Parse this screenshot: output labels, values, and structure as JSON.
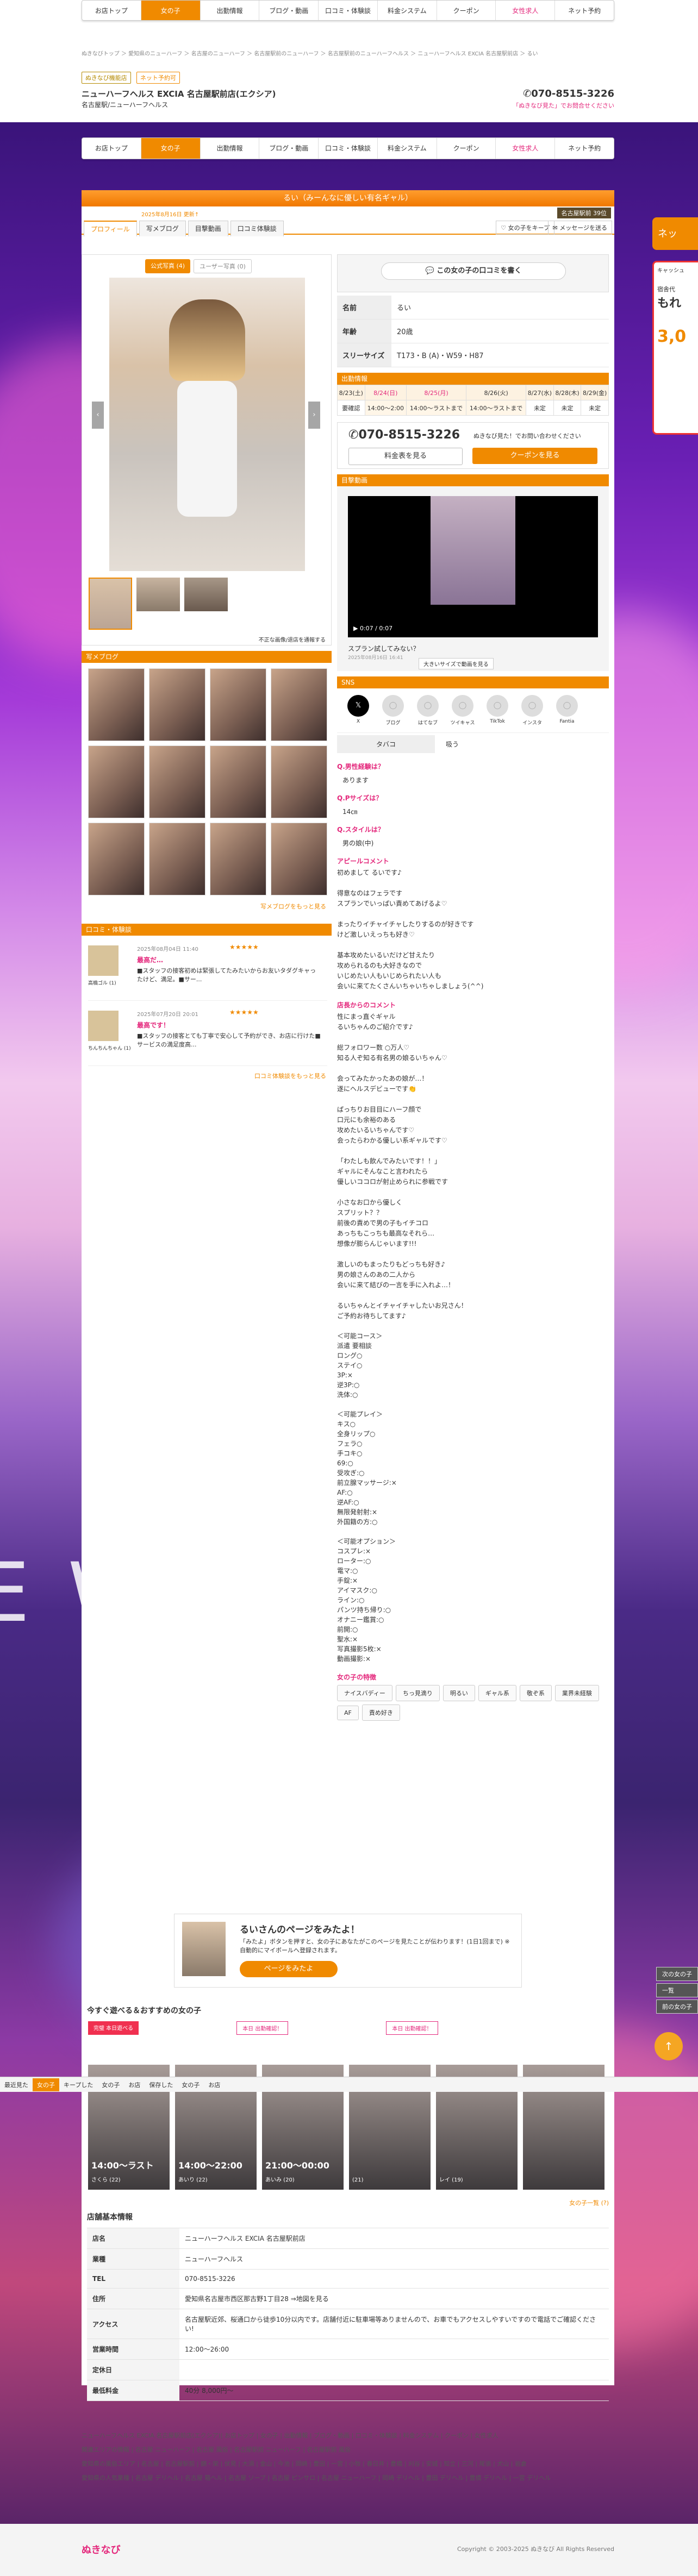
{
  "nav": [
    "お店トップ",
    "女の子",
    "出勤情報",
    "ブログ・動画",
    "口コミ・体験談",
    "料金システム",
    "クーポン",
    "女性求人",
    "ネット予約"
  ],
  "topbar": {
    "badge1": "ぬきなび機能店",
    "badge2": "ネット予約可",
    "shop_name": "ニューハーフヘルス EXCIA 名古屋駅前店(エクシア)",
    "shop_sub": "名古屋駅/ニューハーフヘルス",
    "phone": "070-8515-3226",
    "phone_note": "「ぬきなび見た」でお問合せください",
    "breadcrumb": "ぬきなびトップ ＞ 愛知県のニューハーフ ＞ 名古屋のニューハーフ ＞ 名古屋駅前のニューハーフ ＞ 名古屋駅前のニューハーフヘルス ＞ ニューハーフヘルス EXCIA 名古屋駅前店 ＞ るい"
  },
  "profile_header": {
    "title": "るい（みーんなに優しい有名ギャル）",
    "updated": "2025年8月16日 更新↑",
    "views": "名古屋駅前 39位",
    "fav_btn": "女の子をキープ",
    "mail_btn": "メッセージを送る"
  },
  "tabs": [
    "プロフィール",
    "写メブログ",
    "目撃動画",
    "口コミ体験談"
  ],
  "photo_tabs": [
    "公式写真 (4)",
    "ユーザー写真 (0)"
  ],
  "photo_report": "不正な画像/退店を通報する",
  "review_btn": "この女の子の口コミを書く",
  "profile": [
    {
      "label": "名前",
      "value": "るい"
    },
    {
      "label": "年齢",
      "value": "20歳"
    },
    {
      "label": "スリーサイズ",
      "value": "T173・B (A)・W59・H87"
    }
  ],
  "schedule": {
    "title": "出勤情報",
    "days": [
      "8/23(土)",
      "8/24(日)",
      "8/25(月)",
      "8/26(火)",
      "8/27(水)",
      "8/28(木)",
      "8/29(金)"
    ],
    "times": [
      "要確認",
      "14:00〜2:00",
      "14:00〜ラストまで",
      "14:00〜ラストまで",
      "未定",
      "未定",
      "未定"
    ]
  },
  "contact": {
    "phone": "070-8515-3226",
    "note": "ぬきなび見た！でお問い合わせください",
    "price_btn": "料金表を見る",
    "coupon_btn": "クーポンを見る"
  },
  "video": {
    "title": "目撃動画",
    "time": "0:07 / 0:07",
    "caption": "スプラン試してみない？",
    "date": "2025年08月16日 16:41",
    "big_btn": "大きいサイズで動画を見る"
  },
  "sns": {
    "title": "SNS",
    "items": [
      "X",
      "ブログ",
      "はてなブ",
      "ツイキャス",
      "TikTok",
      "インスタ",
      "Fantia"
    ]
  },
  "qa_tabs": [
    "タバコ",
    "吸う"
  ],
  "qa": [
    {
      "q": "Q.男性経験は？",
      "a": "あります"
    },
    {
      "q": "Q.Pサイズは？",
      "a": "14㎝"
    },
    {
      "q": "Q.スタイルは？",
      "a": "男の娘(中)"
    }
  ],
  "appeal": {
    "title": "アピールコメント",
    "text": "初めまして るいです♪\n\n得意なのはフェラです\nスプランでいっぱい責めてあげるよ♡\n\nまったりイチャイチャしたりするのが好きです\nけど激しいえっちも好き♡\n\n基本攻めたいるいだけど甘えたり\n攻められるのも大好きなので\nいじめたい人もいじめられたい人も\n会いに来てたくさんいちゃいちゃしましょう(^^)"
  },
  "staff": {
    "title": "店長からのコメント",
    "text": "性にまっ直ぐギャル\nるいちゃんのご紹介です♪\n\n総フォロワー数 ○万人♡\n知る人ぞ知る有名男の娘るいちゃん♡\n\n会ってみたかったあの娘が…！\n遂にヘルスデビューです👏\n\nぱっちりお目目にハーフ顔で\n口元にも余裕のある\n攻めたいるいちゃんです♡\n会ったらわかる優しい系ギャルです♡\n\n「わたしも飲んでみたいです！！」\nギャルにそんなこと言われたら\n優しいココロが射止められに参戦です\n\n小さなお口から優しく\nスプリット？？\n前後の責めで男の子もイチコロ\nあっちもこっちも最高なそれら…\n想像が膨らんじゃいます!!!\n\n激しいのもまったりもどっちも好き♪\n男の娘さんのあの二人から\n会いに来て結びの一言を手に入れよ…！\n\nるいちゃんとイチャイチャしたいお兄さん！\nご予約お待ちしてます♪"
  },
  "options": {
    "course_title": "＜可能コース＞",
    "courses": [
      "派遣 要相談",
      "ロング○",
      "ステイ○",
      "3P:×",
      "逆3P:○",
      "洗体:○"
    ],
    "play_title": "＜可能プレイ＞",
    "plays": [
      "キス○",
      "全身リップ○",
      "フェラ○",
      "手コキ○",
      "69:○",
      "受攻ぎ:○",
      "前立腺マッサージ:×",
      "AF:○",
      "逆AF:○",
      "無限発射射:×",
      "外国籍の方:○"
    ],
    "opt_title": "＜可能オプション＞",
    "opts": [
      "コスプレ:×",
      "ローター:○",
      "電マ:○",
      "手錠:×",
      "アイマスク:○",
      "ライン:○",
      "パンツ持ち帰り:○",
      "オナニー鑑賞:○",
      "前開:○",
      "聖水:×",
      "写真撮影5枚:×",
      "動画撮影:×"
    ]
  },
  "traits": {
    "title": "女の子の特徴",
    "tags": [
      "ナイスバディー",
      "ちっ見滴り",
      "明るい",
      "ギャル系",
      "敬ぞ系",
      "業界未経験",
      "AF",
      "責め好き"
    ]
  },
  "blog_title": "写メブログ",
  "blog_more": "写メブログをもっと見る",
  "kuchikomi": {
    "title": "口コミ・体験談",
    "items": [
      {
        "date": "2025年08月04日 11:40",
        "title": "最高だ…",
        "text": "■スタッフの接客初めは緊張してたみたいからお友いタダグキャったけど、満足。■サー...",
        "user": "高橋ゴル (1)"
      },
      {
        "date": "2025年07月20日 20:01",
        "title": "最高です！",
        "text": "■スタッフの接客とても丁寧で安心して予約ができ、お店に行けた■サービスの満足度高...",
        "user": "ちんちんちゃん (1)"
      }
    ],
    "more": "口コミ体験談をもっと見る"
  },
  "mypage": {
    "title": "るいさんのページをみたよ！",
    "text": "「みたよ」ボタンを押すと、女の子にあなたがこのページを見たことが伝わります！(1日1回まで) ※自動的にマイボールへ登録されます。",
    "btn": "ページをみたよ"
  },
  "recommend": {
    "title": "今すぐ遊べる＆おすすめの女の子",
    "badges": [
      "完璧 本日遊べる",
      "本日 出勤確認！",
      "本日 出勤確認！"
    ],
    "cards": [
      {
        "time": "14:00〜ラスト",
        "name": "さくら (22)"
      },
      {
        "time": "14:00〜22:00",
        "name": "あいり (22)"
      },
      {
        "time": "21:00〜00:00",
        "name": "あいみ (20)"
      },
      {
        "time": "",
        "name": "(21)"
      },
      {
        "time": "",
        "name": "レイ (19)"
      },
      {
        "time": "",
        "name": ""
      }
    ],
    "more": "女の子一覧 (?)"
  },
  "shopinfo": {
    "title": "店舗基本情報",
    "rows": [
      {
        "k": "店名",
        "v": "ニューハーフヘルス EXCIA 名古屋駅前店"
      },
      {
        "k": "業種",
        "v": "ニューハーフヘルス"
      },
      {
        "k": "TEL",
        "v": "070-8515-3226"
      },
      {
        "k": "住所",
        "v": "愛知県名古屋市西区那古野1丁目28 ⇒地図を見る"
      },
      {
        "k": "アクセス",
        "v": "名古屋駅近郊、桜通口から徒歩10分以内です。店舗付近に駐車場等ありませんので、お車でもアクセスしやすいですので電話でご確認ください!"
      },
      {
        "k": "営業時間",
        "v": "12:00〜26:00"
      },
      {
        "k": "定休日",
        "v": ""
      },
      {
        "k": "最低料金",
        "v": "40分 8,000円〜"
      }
    ]
  },
  "footer": {
    "line1": "ニューハーフヘルス EXCIA 名古屋駅前店(エクシア)| お店トップ | 女の子 | 出勤情報 | ブログ・動画 | 口コミ・体験談 | 料金システム | クーポン | 女性求人",
    "line2": "関連エリアの情報 | 名古屋 ニューハーフ | 名古屋 風俗 | 名古屋駅前 ニューハーフ | 名古屋駅前 風俗",
    "line3": "愛知県の風俗エリア | 名古屋 | 名古屋駅前 | 錦・栄 | 伏見 | 大須 | 金山 | 今池 | 岡崎 | 豊田 | 一宮 | 小牧 | 春日井 | 豊橋 | 刈谷 | 安城 | 知立 | 三河 | 尾張 | 犬山 | 岩倉",
    "line4": "愛知県の人気業種 | 名古屋 デリヘル | 名古屋 箱ヘル | 名古屋 ソープ | 名古屋 ピンサロ | 名古屋 ニューハーフ | 岡崎 デリヘル | 豊田 デリヘル | 豊橋 デリヘル | 一宮 デリヘル",
    "logo": "ぬきなび",
    "copy": "Copyright © 2003-2025 ぬきなび All Rights Reserved"
  },
  "side": {
    "banner_top": "ネッ",
    "banner2_a": "キャッシュ",
    "banner2_b": "宿舎代",
    "banner2_c": "もれ",
    "banner2_d": "3,0",
    "side_links": [
      "次の女の子",
      "一覧",
      "前の女の子"
    ]
  },
  "bottombar": [
    "最近見た",
    "女の子",
    "キープした",
    "女の子",
    "お店",
    "保存した",
    "女の子",
    "お店"
  ],
  "colors": {
    "accent": "#f08a00",
    "pink": "#e4287c"
  }
}
